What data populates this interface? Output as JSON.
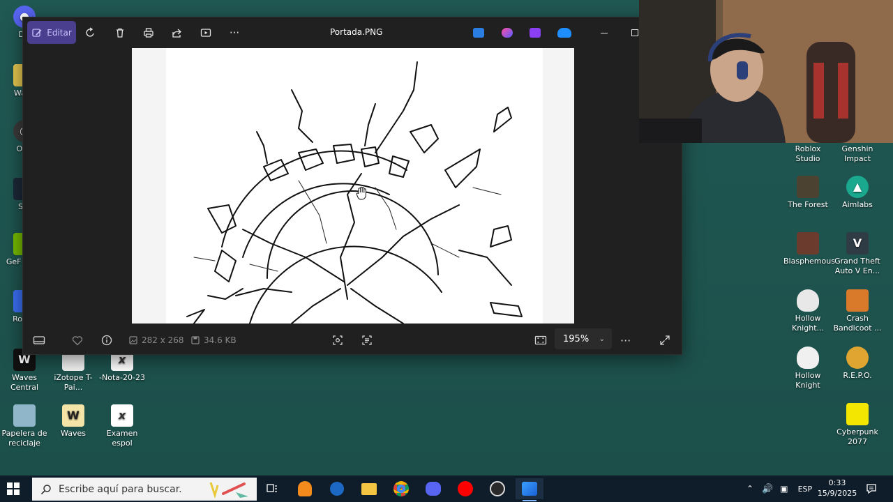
{
  "window": {
    "title": "Portada.PNG",
    "edit_label": "Editar",
    "dimensions": "282 x 268",
    "file_size": "34.6 KB",
    "zoom": "195%"
  },
  "desktop_left": [
    {
      "label": "Dis",
      "color": "#5865f2",
      "glyph": "●"
    },
    {
      "label": "Wave",
      "color": "#e5c64f",
      "glyph": ""
    },
    {
      "label": "OBS",
      "color": "#3a3a3a",
      "glyph": "◎"
    },
    {
      "label": "Ste",
      "color": "#1b2838",
      "glyph": ""
    },
    {
      "label": "GeF Expe",
      "color": "#76b900",
      "glyph": ""
    },
    {
      "label": "Ro Pla",
      "color": "#3a6df0",
      "glyph": ""
    }
  ],
  "desktop_bottom": [
    {
      "label": "Waves Central",
      "color": "#111111",
      "glyph": "W"
    },
    {
      "label": "iZotope T-Pai...",
      "color": "#f2f2f2",
      "glyph": ""
    },
    {
      "label": "-Nota-20-23",
      "color": "#ffffff",
      "glyph": "x"
    },
    {
      "label": "Papelera de reciclaje",
      "color": "#8fb7c9",
      "glyph": ""
    },
    {
      "label": "Waves",
      "color": "#f4e4a8",
      "glyph": "W"
    },
    {
      "label": "Examen espol",
      "color": "#ffffff",
      "glyph": "x"
    }
  ],
  "desktop_right": [
    {
      "label": "Roblox Studio",
      "color": "",
      "glyph": ""
    },
    {
      "label": "Genshin Impact",
      "color": "",
      "glyph": ""
    },
    {
      "label": "The Forest",
      "color": "#4b4232",
      "glyph": ""
    },
    {
      "label": "Aimlabs",
      "color": "#1aa88e",
      "glyph": "▲"
    },
    {
      "label": "Blasphemous",
      "color": "#6b3b2e",
      "glyph": ""
    },
    {
      "label": "Grand Theft Auto V En...",
      "color": "#2f3b45",
      "glyph": "V"
    },
    {
      "label": "Hollow Knight...",
      "color": "#e8e8e8",
      "glyph": ""
    },
    {
      "label": "Crash Bandicoot ...",
      "color": "#d97a2a",
      "glyph": ""
    },
    {
      "label": "Hollow Knight",
      "color": "#f0f0f0",
      "glyph": ""
    },
    {
      "label": "R.E.P.O.",
      "color": "#e0a530",
      "glyph": ""
    },
    {
      "label": "Cyberpunk 2077",
      "color": "#f3e600",
      "glyph": ""
    }
  ],
  "taskbar": {
    "search_placeholder": "Escribe aquí para buscar.",
    "language": "ESP",
    "time": "0:33",
    "date": "15/9/2025"
  },
  "colors": {
    "accent": "#4a3e8e",
    "desktop": "#1f5550",
    "taskbar": "#0f1d2a"
  }
}
